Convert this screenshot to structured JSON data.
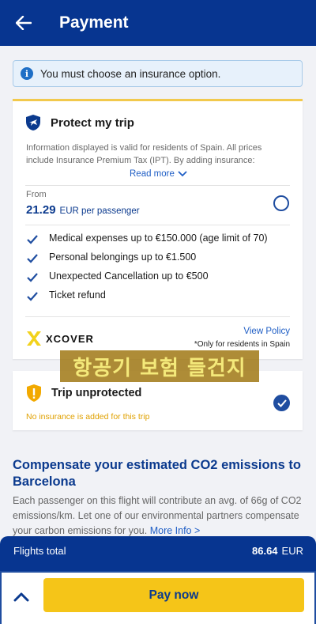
{
  "header": {
    "title": "Payment",
    "back_icon": "arrow-left-icon",
    "background": "#073590"
  },
  "notice": {
    "icon": "info-icon",
    "icon_glyph": "i",
    "text": "You must choose an insurance option."
  },
  "protect_option": {
    "icon": "shield-plane-icon",
    "title": "Protect my trip",
    "description": "Information displayed is valid for residents of Spain. All prices include Insurance Premium Tax (IPT). By adding insurance:",
    "read_more": "Read more",
    "from_label": "From",
    "price": "21.29",
    "price_unit": "EUR per passenger",
    "selected": false,
    "benefits": [
      "Medical expenses up to €150.000 (age limit of 70)",
      "Personal belongings up to €1.500",
      "Unexpected Cancellation up to €500",
      "Ticket refund"
    ],
    "provider": "XCOVER",
    "view_policy": "View Policy",
    "residents_note": "*Only for residents in Spain",
    "accent": "#f2c94c"
  },
  "overlay_caption": "항공기 보험 들건지",
  "unprotected_option": {
    "icon": "warning-shield-icon",
    "title": "Trip unprotected",
    "note": "No insurance is added for this trip",
    "selected": true,
    "note_color": "#e0a100"
  },
  "co2": {
    "title": "Compensate your estimated CO2 emissions to Barcelona",
    "body": "Each passenger on this flight will contribute an avg. of 66g of CO2 emissions/km. Let one of our environmental partners compensate your carbon emissions for you.",
    "more_info": "More Info >"
  },
  "footer": {
    "total_label": "Flights total",
    "total_amount": "86.64",
    "currency": "EUR",
    "pay_button": "Pay now",
    "expand_icon": "chevron-up-icon",
    "pay_color": "#f5c518"
  }
}
